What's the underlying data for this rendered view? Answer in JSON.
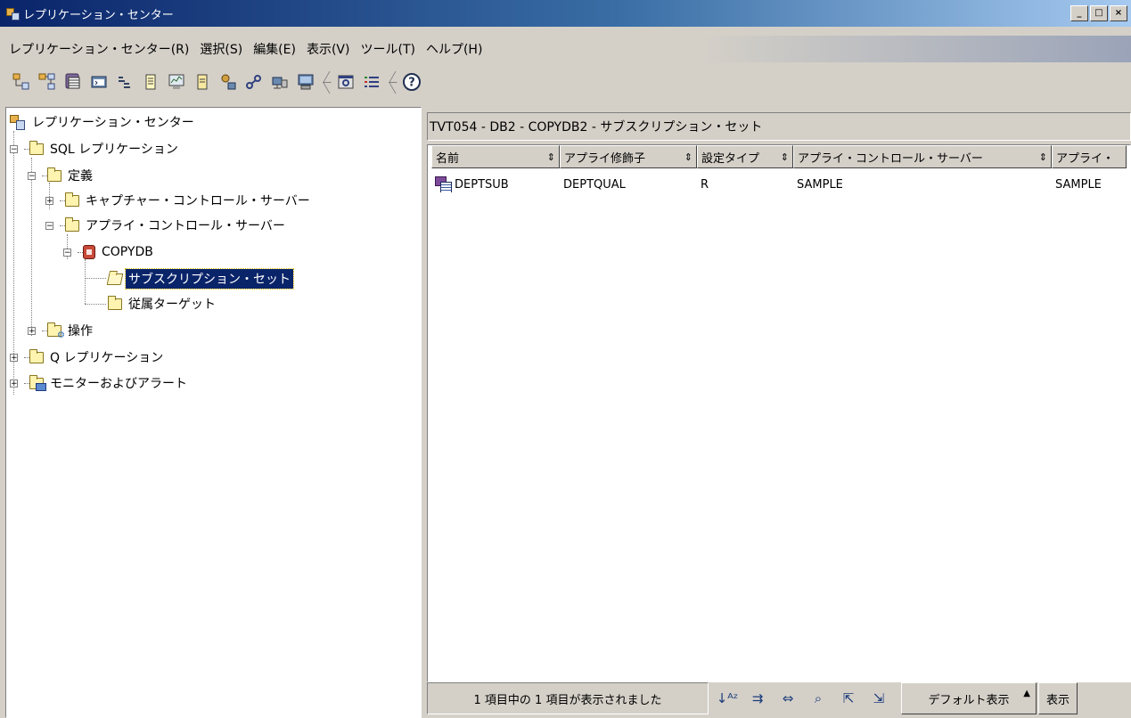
{
  "window": {
    "title": "レプリケーション・センター",
    "min": "_",
    "max": "□",
    "close": "×"
  },
  "menu": [
    "レプリケーション・センター(R)",
    "選択(S)",
    "編集(E)",
    "表示(V)",
    "ツール(T)",
    "ヘルプ(H)"
  ],
  "toolbar": {
    "help_glyph": "?",
    "icons": [
      "replication-icon",
      "replication-multi-icon",
      "database-icon",
      "command-window-icon",
      "task-icon",
      "journal-icon",
      "monitor-icon",
      "note-icon",
      "key-user-icon",
      "link-icon",
      "satellite-icon",
      "computer-icon",
      "settings-icon",
      "list-icon",
      "help-icon"
    ]
  },
  "tree": {
    "root": "レプリケーション・センター",
    "sql": "SQL レプリケーション",
    "definitions": "定義",
    "capture": "キャプチャー・コントロール・サーバー",
    "apply": "アプライ・コントロール・サーバー",
    "copydb": "COPYDB",
    "subscription": "サブスクリプション・セット",
    "targets": "従属ターゲット",
    "operations": "操作",
    "q": "Q レプリケーション",
    "monitor": "モニターおよびアラート",
    "expand_plus": "+",
    "expand_minus": "−"
  },
  "panel": {
    "header": "TVT054 - DB2 - COPYDB2 - サブスクリプション・セット",
    "columns": [
      "名前",
      "アプライ修飾子",
      "設定タイプ",
      "アプライ・コントロール・サーバー",
      "アプライ・"
    ],
    "sort_glyph": "⇕",
    "rows": [
      {
        "name": "DEPTSUB",
        "qualifier": "DEPTQUAL",
        "type": "R",
        "server": "SAMPLE",
        "extra": "SAMPLE"
      }
    ],
    "scroll_left": "◀",
    "scroll_right": "▶"
  },
  "status": {
    "text": "1 項目中の 1 項目が表示されました",
    "icons": [
      "sort-az-icon",
      "filter-icon",
      "columns-icon",
      "find-icon",
      "select-add-icon",
      "select-remove-icon"
    ],
    "icon_glyphs": [
      "↓ᴬᶻ",
      "⇉",
      "⇔",
      "⌕",
      "⇱",
      "⇲"
    ],
    "default_view": "デフォルト表示",
    "default_caret": "▲",
    "view": "表示"
  }
}
